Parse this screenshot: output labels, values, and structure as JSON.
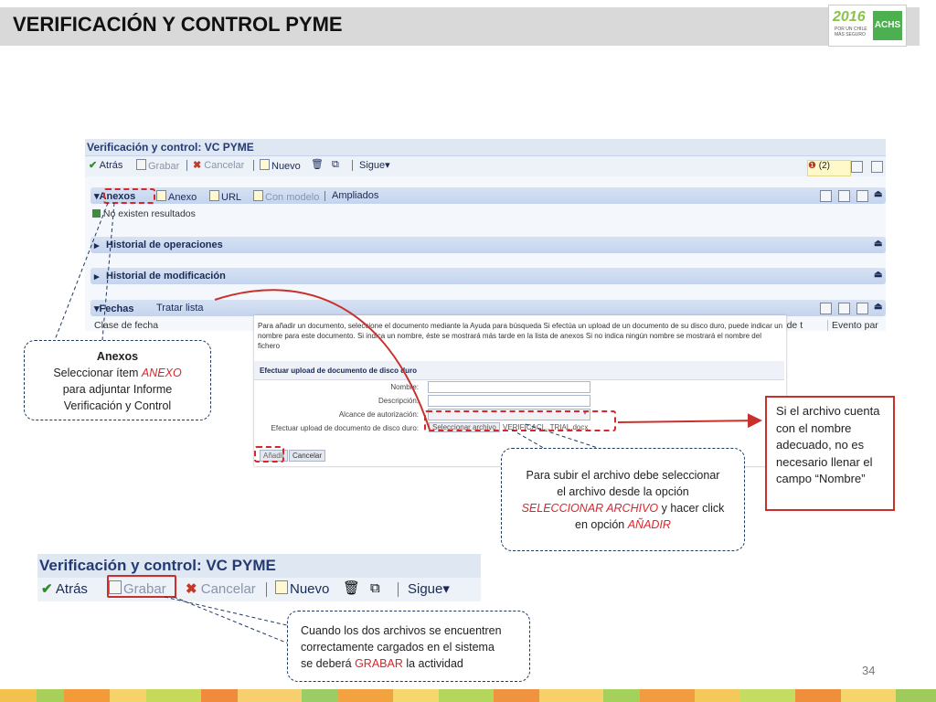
{
  "slide": {
    "title": "VERIFICACIÓN Y CONTROL PYME",
    "page_number": "34",
    "logo": {
      "year": "2016",
      "tagline": "POR UN CHILE MÁS SEGURO",
      "brand": "ACHS"
    }
  },
  "sap_panel": {
    "title": "Verificación y control: VC PYME",
    "toolbar": {
      "back": "Atrás",
      "save": "Grabar",
      "cancel": "Cancelar",
      "new": "Nuevo",
      "next": "Sigue",
      "alerts": "(2)"
    },
    "sections": {
      "anexos": {
        "title": "Anexos",
        "actions": [
          "Anexo",
          "URL",
          "Con modelo",
          "Ampliados"
        ],
        "empty_msg": "No existen resultados"
      },
      "historial_operaciones": "Historial de operaciones",
      "historial_modificacion": "Historial de modificación",
      "fechas": {
        "title": "Fechas",
        "action": "Tratar lista",
        "col1": "Clase de fecha",
        "col2": "ad de t",
        "col3": "Evento par"
      }
    }
  },
  "upload_dialog": {
    "instructions": "Para añadir un documento, seleccione el documento mediante la Ayuda para búsqueda Si efectúa un upload de un documento de su disco duro, puede indicar un nombre para este documento. Si indica un nombre, éste se mostrará más tarde en la lista de anexos Si no indica ningún nombre se mostrará el nombre del fichero",
    "section_title": "Efectuar upload de documento de disco duro",
    "fields": {
      "name": "Nombre:",
      "description": "Descripción:",
      "scope": "Alcance de autorización:",
      "upload": "Efectuar upload de documento de disco duro:"
    },
    "file_button": "Seleccionar archivo",
    "file_name": "VERIFICACI...TRIAL.docx",
    "add": "Añadir",
    "cancel": "Cancelar"
  },
  "bottom_panel": {
    "title": "Verificación y control: VC PYME",
    "toolbar": {
      "back": "Atrás",
      "save": "Grabar",
      "cancel": "Cancelar",
      "new": "Nuevo",
      "next": "Sigue"
    }
  },
  "callouts": {
    "anexos": {
      "heading": "Anexos",
      "l1a": "Seleccionar ítem ",
      "l1b": "ANEXO",
      "l2": "para adjuntar  Informe",
      "l3": "Verificación y Control"
    },
    "upload": {
      "l1": "Para subir el archivo debe seleccionar",
      "l2": "el archivo  desde la opción",
      "l3a": "SELECCIONAR ARCHIVO",
      "l3b": " y  hacer click",
      "l4a": "en opción ",
      "l4b": "AÑADIR"
    },
    "nombre": {
      "text": "Si el archivo cuenta con el nombre adecuado, no es necesario llenar el campo “Nombre”"
    },
    "grabar": {
      "l1": "Cuando los dos archivos se encuentren",
      "l2": "correctamente cargados en el sistema",
      "l3a": "se deberá ",
      "l3b": "GRABAR",
      "l3c": " la actividad"
    }
  }
}
